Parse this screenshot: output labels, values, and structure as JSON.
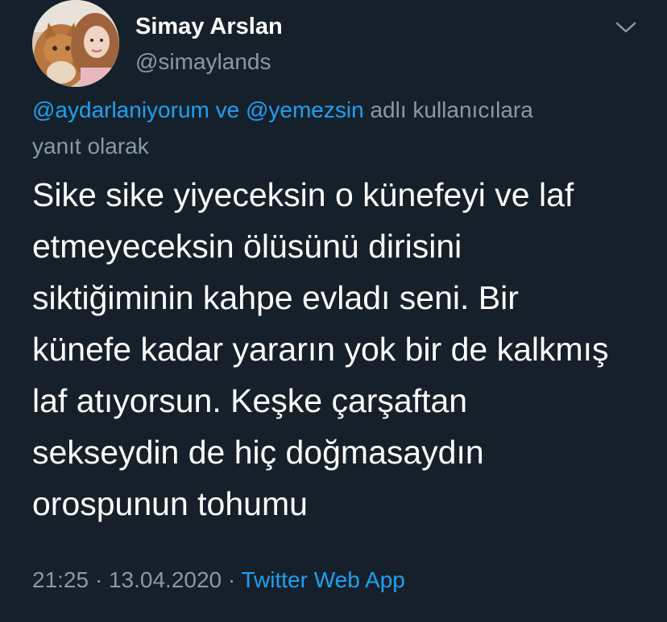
{
  "author": {
    "display_name": "Simay Arslan",
    "handle": "@simaylands",
    "avatar_icon": "profile-photo-with-cat"
  },
  "menu": {
    "icon": "chevron-down-icon"
  },
  "reply_context": {
    "mention_1": "@aydarlaniyorum",
    "connector": "ve",
    "mention_2": "@yemezsin",
    "suffix_line1": "adlı kullanıcılara",
    "suffix_line2": "yanıt olarak"
  },
  "tweet": {
    "lines": [
      "Sike sike yiyeceksin o künefeyi ve laf",
      "etmeyeceksin ölüsünü dirisini",
      "siktiğiminin kahpe evladı seni. Bir",
      "künefe kadar yararın yok bir de kalkmış",
      "laf atıyorsun. Keşke çarşaftan",
      "sekseydin de hiç doğmasaydın",
      "orospunun tohumu"
    ]
  },
  "meta": {
    "time": "21:25",
    "separator": "·",
    "date": "13.04.2020",
    "source": "Twitter Web App"
  },
  "colors": {
    "background": "#15202b",
    "text": "#ffffff",
    "secondary": "#8899a6",
    "accent": "#1da1f2"
  }
}
